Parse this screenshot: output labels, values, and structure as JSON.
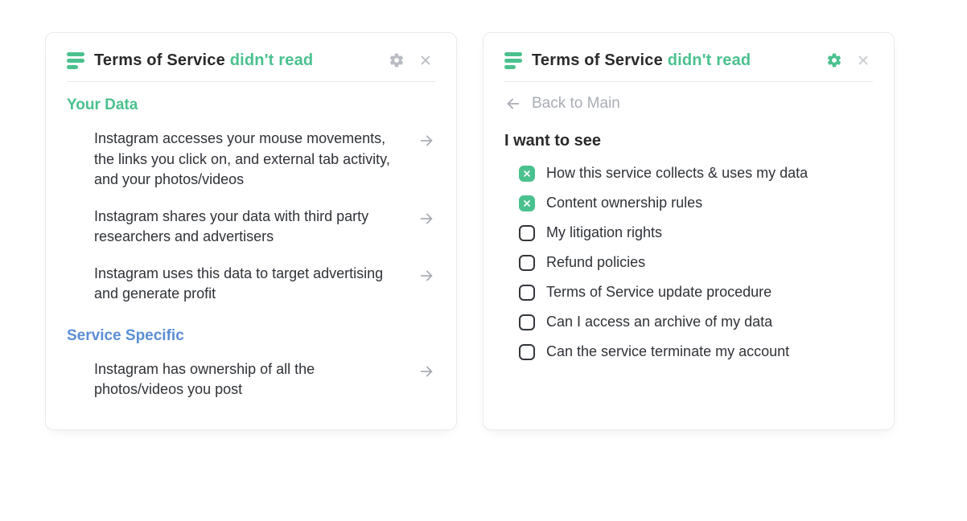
{
  "app": {
    "title_strong": "Terms of Service",
    "title_sub": "didn't read"
  },
  "left": {
    "settings_active": false,
    "sections": [
      {
        "title": "Your Data",
        "color": "green",
        "items": [
          "Instagram accesses your mouse movements, the links you click on, and external tab activity, and your photos/videos",
          "Instagram shares your data with third party researchers and advertisers",
          "Instagram uses this data to target advertising and generate profit"
        ]
      },
      {
        "title": "Service Specific",
        "color": "blue",
        "items": [
          "Instagram has ownership of all the photos/videos you post"
        ]
      }
    ]
  },
  "right": {
    "settings_active": true,
    "back_label": "Back to Main",
    "heading": "I want to see",
    "options": [
      {
        "label": "How this service collects & uses my data",
        "checked": true
      },
      {
        "label": "Content ownership rules",
        "checked": true
      },
      {
        "label": "My litigation rights",
        "checked": false
      },
      {
        "label": "Refund policies",
        "checked": false
      },
      {
        "label": "Terms of Service update procedure",
        "checked": false
      },
      {
        "label": "Can I access an archive of my data",
        "checked": false
      },
      {
        "label": "Can the service terminate my account",
        "checked": false
      }
    ]
  },
  "colors": {
    "green": "#4ac18e",
    "blue": "#5a8ed6",
    "muted": "#a9adb4"
  }
}
